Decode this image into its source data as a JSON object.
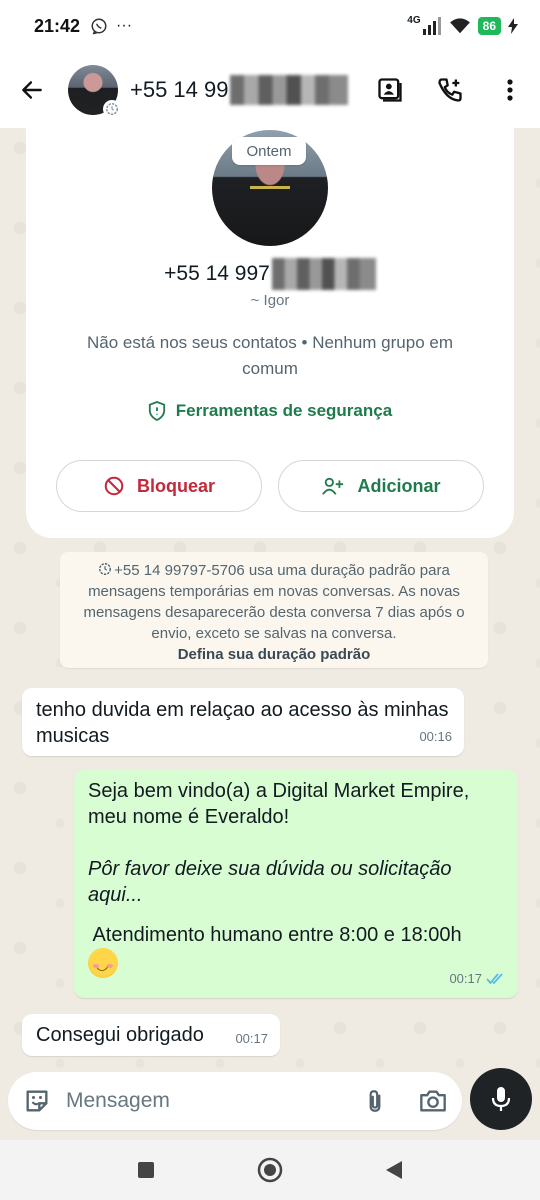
{
  "status_bar": {
    "time": "21:42",
    "extra": "···",
    "network": "4G",
    "battery": "86"
  },
  "header": {
    "title": "+55 14 99"
  },
  "contact_card": {
    "date_pill": "Ontem",
    "phone": "+55 14 997",
    "name": "~ Igor",
    "info": "Não está nos seus contatos • Nenhum grupo em comum",
    "security_label": "Ferramentas de segurança",
    "block_label": "Bloquear",
    "add_label": "Adicionar"
  },
  "system_notice": {
    "text": "+55 14 99797-5706 usa uma duração padrão para mensagens temporárias em novas conversas. As novas mensagens desaparecerão desta conversa 7 dias após o envio, exceto se salvas na conversa.",
    "link": "Defina sua duração padrão"
  },
  "messages": [
    {
      "direction": "in",
      "text": "tenho duvida em relaçao ao acesso às minhas musicas",
      "time": "00:16"
    },
    {
      "direction": "out",
      "line1": "Seja bem vindo(a) a Digital Market Empire, meu nome é Everaldo!",
      "line2": "Pôr favor deixe sua dúvida ou solicitação aqui...",
      "line3": " Atendimento humano entre 8:00 e 18:00h",
      "emoji": "smiling-face",
      "time": "00:17",
      "read": true
    },
    {
      "direction": "in",
      "text": "Consegui obrigado",
      "time": "00:17"
    }
  ],
  "composer": {
    "placeholder": "Mensagem"
  },
  "colors": {
    "chat_bg": "#efeae2",
    "outgoing": "#d9fdd3",
    "accent_green": "#1f7a4c",
    "block_red": "#c2293b",
    "battery": "#1fb85a"
  }
}
